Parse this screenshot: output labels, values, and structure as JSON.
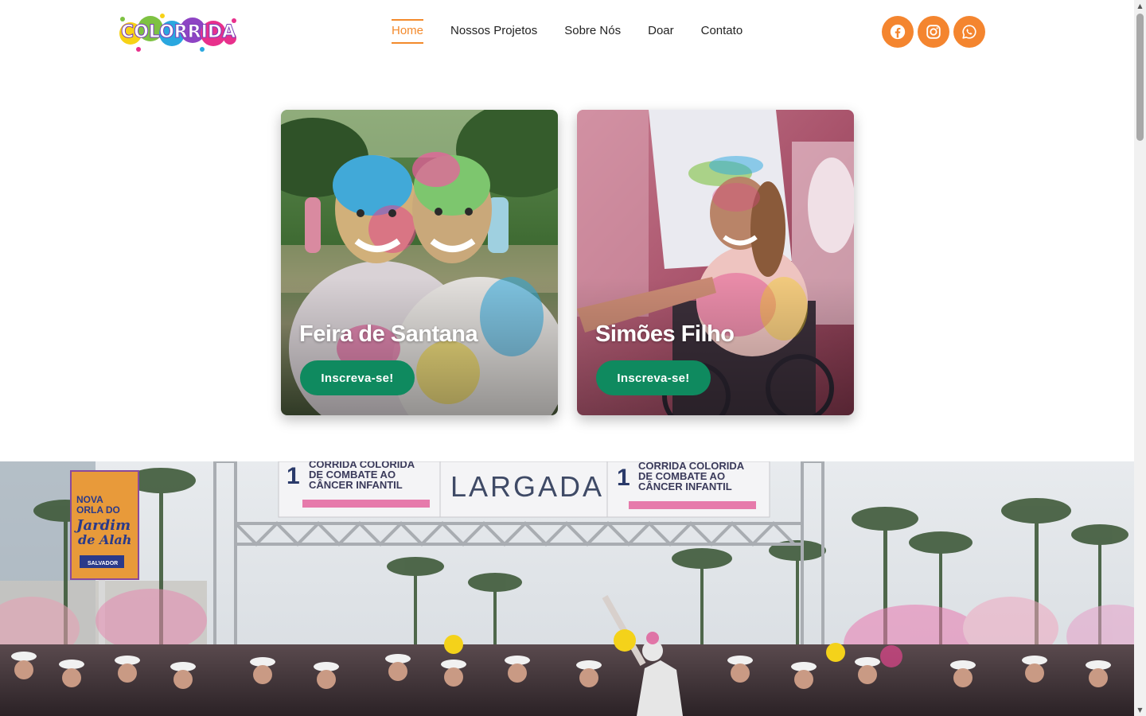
{
  "header": {
    "logo_text": "COLORRIDA",
    "nav": [
      {
        "label": "Home",
        "active": true
      },
      {
        "label": "Nossos Projetos",
        "active": false
      },
      {
        "label": "Sobre Nós",
        "active": false
      },
      {
        "label": "Doar",
        "active": false
      },
      {
        "label": "Contato",
        "active": false
      }
    ],
    "socials": [
      {
        "icon": "facebook-icon"
      },
      {
        "icon": "instagram-icon"
      },
      {
        "icon": "whatsapp-icon"
      }
    ],
    "accent_color": "#f4852f"
  },
  "cards": [
    {
      "title": "Feira de Santana",
      "button": "Inscreva-se!"
    },
    {
      "title": "Simões Filho",
      "button": "Inscreva-se!"
    }
  ],
  "button_color": "#0f8a5f",
  "hero": {
    "banner_left": [
      "CORRIDA COLORIDA",
      "DE COMBATE AO",
      "CÂNCER INFANTIL"
    ],
    "banner_center": "LARGADA",
    "banner_right": [
      "CORRIDA COLORIDA",
      "DE COMBATE AO",
      "CÂNCER INFANTIL"
    ],
    "banner_ordinal": "1",
    "sign": [
      "NOVA",
      "ORLA DO",
      "Jardim",
      "de Alah",
      "SALVADOR"
    ]
  }
}
